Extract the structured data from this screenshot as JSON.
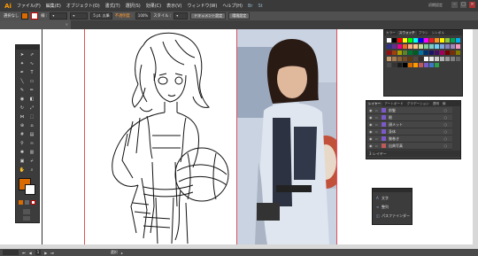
{
  "app": {
    "logo": "Ai"
  },
  "menu": [
    "ファイル(F)",
    "編集(E)",
    "オブジェクト(O)",
    "書式(T)",
    "選択(S)",
    "効果(C)",
    "表示(V)",
    "ウィンドウ(W)",
    "ヘルプ(H)"
  ],
  "workspace_label": "初期設定",
  "window_controls": {
    "minimize": "–",
    "restore": "□",
    "close": "×"
  },
  "control_bar": {
    "selection_label": "選択なし",
    "stroke_label": "線 :",
    "stroke_width": "5 pt. 丸筆",
    "opacity_label": "不透明度 :",
    "opacity": "100%",
    "style_label": "スタイル :",
    "doc_settings": "ドキュメント設定",
    "prefs": "環境設定"
  },
  "doc_tab": {
    "title": "",
    "close": "×"
  },
  "colors": {
    "menubar": "#3a3a3a",
    "panel": "#3c3c3c",
    "accent_orange": "#ff9a00",
    "fill_swatch": "#d96b00",
    "artboard_border": "#e0525a",
    "layer_thumb": "#7c59c8"
  },
  "tools": [
    "selection-tool",
    "direct-selection-tool",
    "magic-wand-tool",
    "lasso-tool",
    "pen-tool",
    "type-tool",
    "line-tool",
    "rectangle-tool",
    "paintbrush-tool",
    "pencil-tool",
    "blob-brush-tool",
    "eraser-tool",
    "rotate-tool",
    "scale-tool",
    "width-tool",
    "free-transform-tool",
    "shape-builder-tool",
    "perspective-tool",
    "mesh-tool",
    "gradient-tool",
    "eyedropper-tool",
    "blend-tool",
    "symbol-sprayer-tool",
    "graph-tool",
    "artboard-tool",
    "slice-tool",
    "hand-tool",
    "zoom-tool"
  ],
  "swatches_panel": {
    "tabs": [
      "カラー",
      "スウォッチ",
      "ブラシ",
      "シンボル"
    ]
  },
  "layers_panel": {
    "tabs": [
      "レイヤー",
      "アートボード",
      "グラデーション",
      "透明",
      "線"
    ],
    "layers": [
      {
        "name": "前髪"
      },
      {
        "name": "眼"
      },
      {
        "name": "顔メット"
      },
      {
        "name": "身体"
      },
      {
        "name": "腕巻き"
      },
      {
        "name": "出典写真"
      }
    ],
    "footer": "3 レイヤー"
  },
  "nav_panel": {
    "items": [
      "文字",
      "整列",
      "パスファインダー"
    ]
  },
  "status_bar": {
    "zoom": "",
    "page": "1",
    "tool": "選択"
  }
}
